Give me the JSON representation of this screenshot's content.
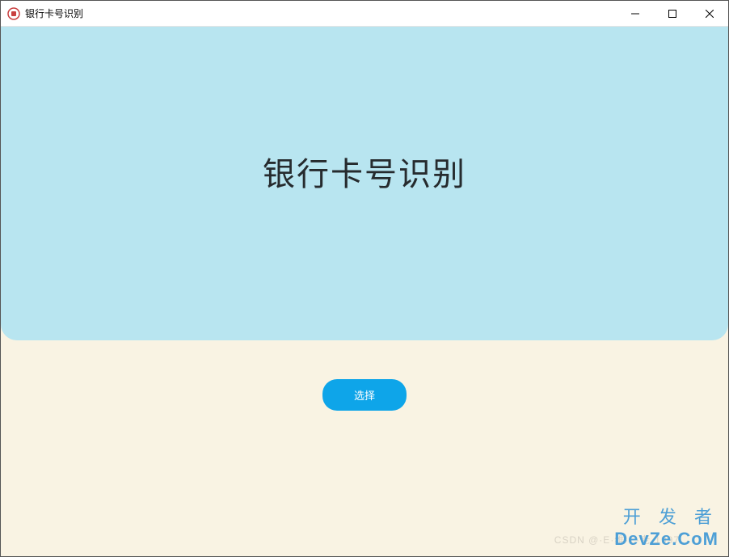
{
  "window": {
    "title": "银行卡号识别",
    "controls": {
      "minimize": "—",
      "maximize": "☐",
      "close": "✕"
    }
  },
  "content": {
    "heading": "银行卡号识别",
    "select_button": "选择"
  },
  "watermark": {
    "csdn": "CSDN @·E·维·E·老·1997",
    "top": "开 发 者",
    "bottom": "DevZe.CoM"
  }
}
